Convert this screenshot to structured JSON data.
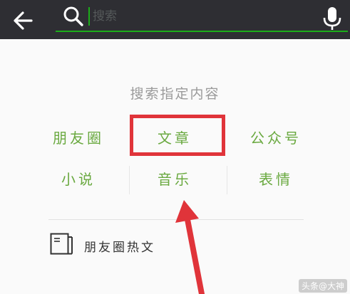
{
  "header": {
    "back_icon": "arrow-left-icon",
    "search_icon": "magnifier-icon",
    "search_placeholder": "搜索",
    "mic_icon": "microphone-icon",
    "accent_color": "#1bad19",
    "bar_color": "#2e2e33"
  },
  "search_panel": {
    "title": "搜索指定内容",
    "items": [
      {
        "label": "朋友圈"
      },
      {
        "label": "文章"
      },
      {
        "label": "公众号"
      },
      {
        "label": "小说"
      },
      {
        "label": "音乐"
      },
      {
        "label": "表情"
      }
    ],
    "item_color": "#6aa940",
    "highlight_color": "#e0343a"
  },
  "hot_articles": {
    "icon": "document-icon",
    "label": "朋友圈热文"
  },
  "watermark": "头条@大神"
}
